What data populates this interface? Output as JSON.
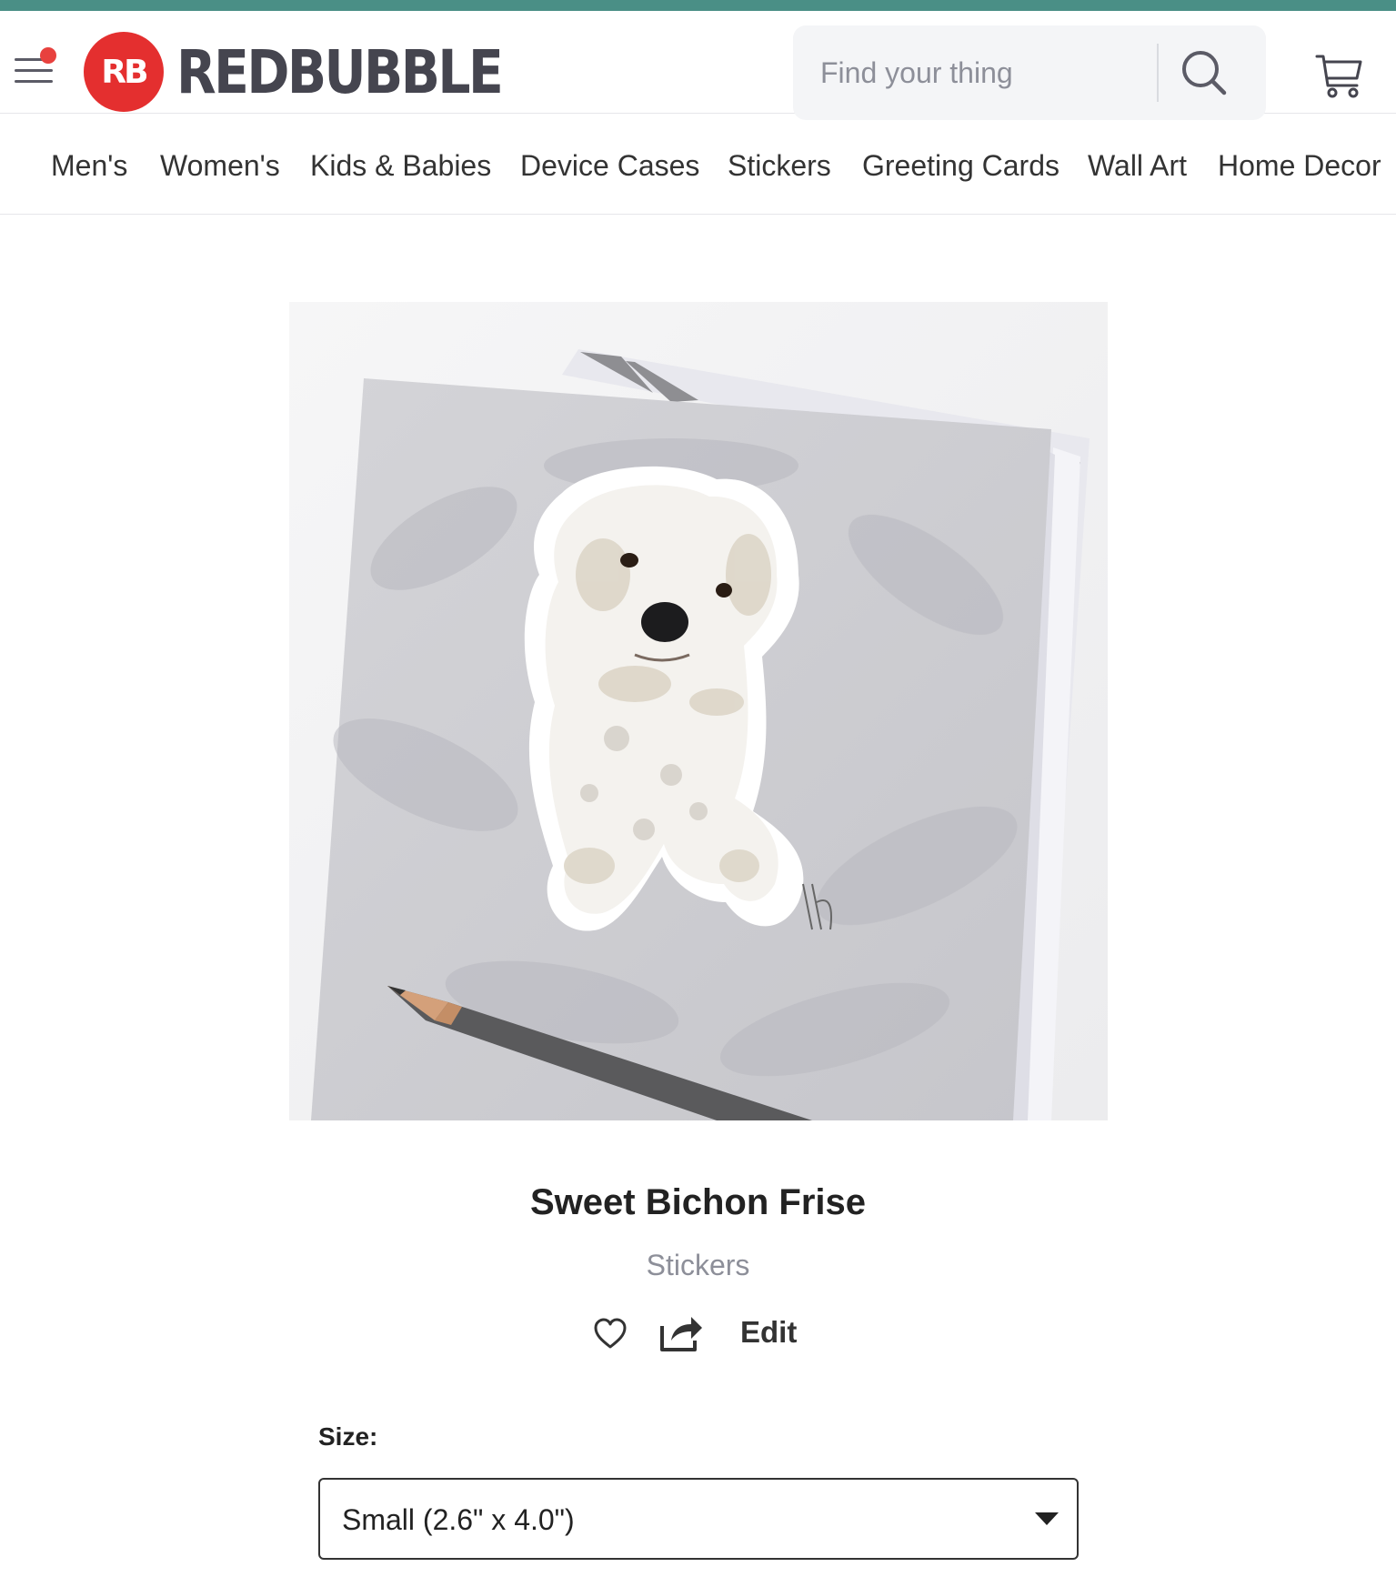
{
  "brand": {
    "logo_mark": "RB",
    "name": "REDBUBBLE",
    "accent_color": "#e42f2f",
    "top_strip_color": "#4a8f86"
  },
  "header": {
    "menu_icon": "hamburger-icon",
    "notification_dot": true,
    "search": {
      "placeholder": "Find your thing",
      "value": "",
      "icon": "search-icon"
    },
    "cart_icon": "cart-icon"
  },
  "nav": {
    "items": [
      {
        "label": "Men's"
      },
      {
        "label": "Women's"
      },
      {
        "label": "Kids & Babies"
      },
      {
        "label": "Device Cases"
      },
      {
        "label": "Stickers"
      },
      {
        "label": "Greeting Cards"
      },
      {
        "label": "Wall Art"
      },
      {
        "label": "Home Decor"
      }
    ]
  },
  "product": {
    "image": "product-image",
    "title": "Sweet Bichon Frise",
    "category": "Stickers",
    "actions": {
      "favorite_icon": "heart-icon",
      "share_icon": "share-icon",
      "edit_label": "Edit"
    },
    "size": {
      "label": "Size:",
      "selected": "Small (2.6\" x 4.0\")"
    }
  }
}
